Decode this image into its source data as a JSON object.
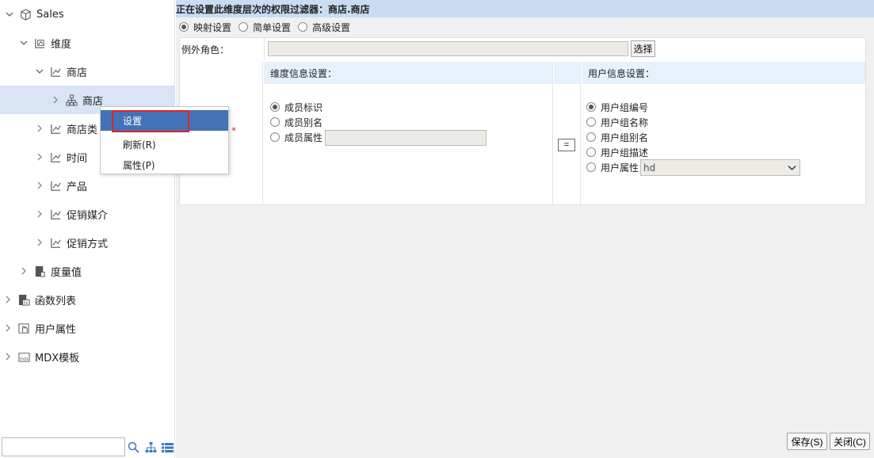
{
  "tree": {
    "nodes": [
      {
        "label": "Sales",
        "icon": "cube-icon"
      },
      {
        "label": "维度",
        "icon": "dimension-icon"
      },
      {
        "label": "商店",
        "icon": "hierarchy-icon"
      },
      {
        "label": "商店",
        "icon": "org-tree-icon"
      },
      {
        "label": "商店类",
        "icon": "hierarchy-icon"
      },
      {
        "label": "时间",
        "icon": "hierarchy-icon"
      },
      {
        "label": "产品",
        "icon": "hierarchy-icon"
      },
      {
        "label": "促销媒介",
        "icon": "hierarchy-icon"
      },
      {
        "label": "促销方式",
        "icon": "hierarchy-icon"
      },
      {
        "label": "度量值",
        "icon": "measure-icon"
      },
      {
        "label": "函数列表",
        "icon": "function-icon"
      },
      {
        "label": "用户属性",
        "icon": "user-attr-icon"
      },
      {
        "label": "MDX模板",
        "icon": "mdx-icon"
      }
    ],
    "search_value": ""
  },
  "context_menu": {
    "items": [
      "设置",
      "刷新(R)",
      "属性(P)"
    ]
  },
  "panel": {
    "title": "正在设置此维度层次的权限过滤器：商店.商店",
    "modes": [
      "映射设置",
      "简单设置",
      "高级设置"
    ],
    "except_label": "例外角色：",
    "except_value": "",
    "choose_label": "选择",
    "dim_header": "维度信息设置：",
    "dim_options": [
      "成员标识",
      "成员别名",
      "成员属性"
    ],
    "dim_attr_value": "",
    "eq_label": "=",
    "user_header": "用户信息设置：",
    "user_options": [
      "用户组编号",
      "用户组名称",
      "用户组别名",
      "用户组描述",
      "用户属性"
    ],
    "user_attr_value": "hd"
  },
  "footer": {
    "save_label": "保存(S)",
    "close_label": "关闭(C)"
  },
  "colors": {
    "title_bg": "#c9dcf2",
    "selected_bg": "#d9e4f5",
    "menu_active": "#4472b7",
    "highlight": "#e0242e"
  }
}
